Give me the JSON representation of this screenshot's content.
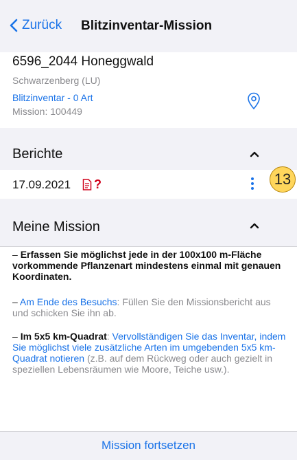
{
  "navbar": {
    "back_label": "Zurück",
    "title": "Blitzinventar-Mission"
  },
  "site": {
    "name": "6596_2044 Honeggwald",
    "location": "Schwarzenberg (LU)",
    "inventory_link": "Blitzinventar  - 0 Art",
    "mission_id": "Mission: 100449",
    "pin_icon": "location-pin-icon"
  },
  "reports": {
    "title": "Berichte",
    "items": [
      {
        "date": "17.09.2021",
        "flag": "?"
      }
    ],
    "badge": "13"
  },
  "mission": {
    "title": "Meine Mission",
    "items": [
      {
        "dash": "– ",
        "bold": "Erfassen Sie möglichst jede in der 100x100 m-Fläche vorkommende Pflanzenart mindestens einmal mit genauen Koordinaten."
      },
      {
        "dash": "– ",
        "link": "Am Ende des Besuchs",
        "text": ": Füllen Sie den Missionsbericht aus und schicken Sie ihn ab."
      },
      {
        "dash": "– ",
        "bold": "Im 5x5 km-Quadrat",
        "sep": ": ",
        "link": "Vervollständigen Sie das Inventar, indem Sie möglichst viele zusätzliche Arten im umgebenden 5x5 km-Quadrat notieren",
        "text": " (z.B. auf dem Rückweg oder auch gezielt in speziellen Lebensräumen wie Moore, Teiche usw.)."
      }
    ]
  },
  "footer": {
    "continue_label": "Mission fortsetzen"
  },
  "colors": {
    "accent": "#1a73e8",
    "alert": "#d0021b",
    "badge": "#ffd65c"
  }
}
